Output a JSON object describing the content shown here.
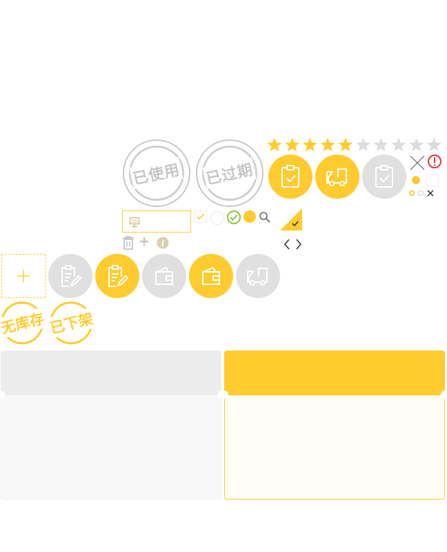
{
  "stamps": {
    "used": "已使用",
    "expired": "已过期",
    "out_of_stock": "无库存",
    "delisted": "已下架"
  },
  "rating": {
    "filled": 5,
    "total": 10
  },
  "colors": {
    "accent": "#ffcb2f",
    "grey": "#e0e0e0",
    "stamp_grey": "#c6c6c6",
    "error": "#e8323c",
    "check_green": "#8cc43e"
  },
  "icons": {
    "clipboard_check": "clipboard-check-icon",
    "truck": "truck-icon",
    "clipboard_edit": "clipboard-edit-icon",
    "wallet": "wallet-icon",
    "trash": "trash-icon",
    "plus": "plus-icon",
    "info": "info-icon",
    "search": "search-icon",
    "close": "close-icon",
    "alert": "alert-icon",
    "chevron_left": "chevron-left-icon",
    "chevron_right": "chevron-right-icon",
    "monitor": "monitor-icon"
  }
}
